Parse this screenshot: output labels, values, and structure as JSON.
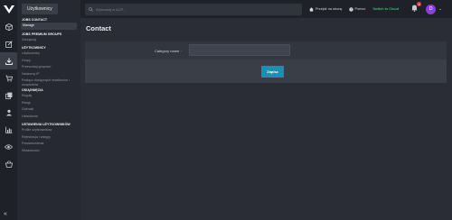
{
  "sidebar": {
    "title": "Użytkownicy",
    "groups": [
      {
        "header": "JOBS CONTACT",
        "items": [
          {
            "label": "Manage",
            "active": true
          }
        ]
      },
      {
        "header": "JOBS PREMIUM GROUPS",
        "items": [
          {
            "label": "Zarządzaj"
          }
        ]
      },
      {
        "header": "UŻYTKOWNICY",
        "items": [
          {
            "label": "Użytkownicy"
          },
          {
            "label": "Grupy"
          },
          {
            "label": "Przeszukaj grupowo"
          },
          {
            "label": "Nadzorcy IP"
          },
          {
            "label": "Podłącz dostępnych redaktorów i urzędników"
          }
        ]
      },
      {
        "header": "OSIĄGNIĘCIA",
        "items": [
          {
            "label": "Reguły"
          },
          {
            "label": "Rangi"
          },
          {
            "label": "Odznaki"
          },
          {
            "label": "Ustawienia"
          }
        ]
      },
      {
        "header": "USTAWIENIA UŻYTKOWNIKÓW",
        "items": [
          {
            "label": "Profile użytkowników"
          },
          {
            "label": "Rejestracja i wstępy"
          },
          {
            "label": "Powiadomienia"
          },
          {
            "label": "Wiadomości"
          }
        ]
      }
    ]
  },
  "rail_icons": [
    "logo-icon",
    "cube-icon",
    "edit-icon",
    "download-icon",
    "cart-icon",
    "copy-icon",
    "people-icon",
    "chart-icon",
    "eye-icon",
    "basket-icon"
  ],
  "topbar": {
    "search_placeholder": "Wyszukaj w ACP...",
    "view_site": "Przejdź na stronę",
    "help": "Pomoc",
    "switch": "Switch to Cloud",
    "notification_count": "3",
    "avatar_letter": "D"
  },
  "content": {
    "title": "Contact",
    "field_label": "Category name",
    "required_mark": "*",
    "field_value": "",
    "save_label": "Zapisz"
  },
  "colors": {
    "accent": "#1f8fb0",
    "switch": "#2ec26e",
    "avatar": "#8a3de0",
    "badge": "#e0424a"
  }
}
